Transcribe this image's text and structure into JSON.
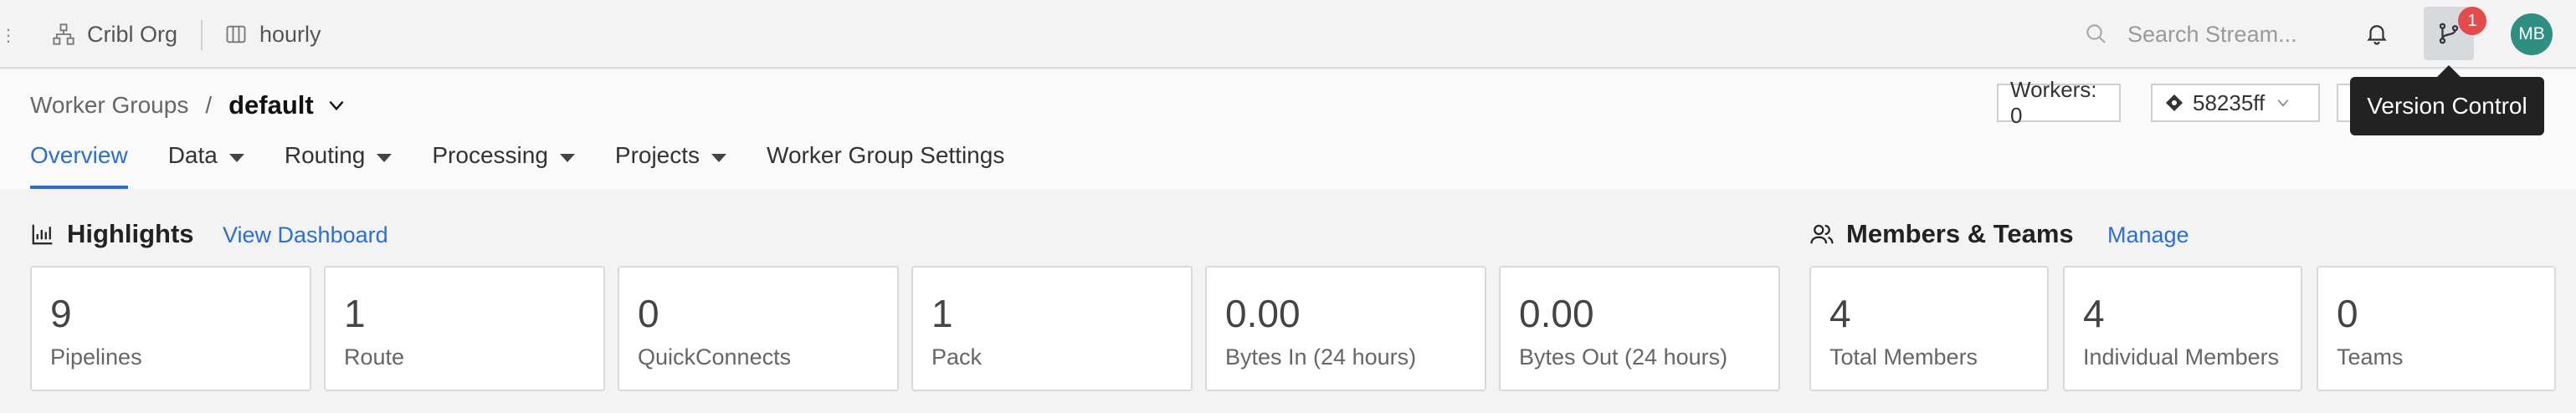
{
  "topbar": {
    "org": "Cribl Org",
    "workspace": "hourly",
    "search_placeholder": "Search Stream...",
    "notification_count": "1",
    "avatar_initials": "MB"
  },
  "breadcrumb": {
    "parent": "Worker Groups",
    "separator": "/",
    "current": "default"
  },
  "tabs": [
    {
      "label": "Overview",
      "active": true
    },
    {
      "label": "Data"
    },
    {
      "label": "Routing"
    },
    {
      "label": "Processing"
    },
    {
      "label": "Projects"
    },
    {
      "label": "Worker Group Settings"
    }
  ],
  "header_controls": {
    "workers": "Workers: 0",
    "commit": "58235ff"
  },
  "tooltip": "Version Control",
  "highlights": {
    "title": "Highlights",
    "link": "View Dashboard",
    "cards": [
      {
        "value": "9",
        "label": "Pipelines"
      },
      {
        "value": "1",
        "label": "Route"
      },
      {
        "value": "0",
        "label": "QuickConnects"
      },
      {
        "value": "1",
        "label": "Pack"
      },
      {
        "value": "0.00",
        "label": "Bytes In (24 hours)"
      },
      {
        "value": "0.00",
        "label": "Bytes Out (24 hours)"
      }
    ]
  },
  "members": {
    "title": "Members & Teams",
    "link": "Manage",
    "cards": [
      {
        "value": "4",
        "label": "Total Members"
      },
      {
        "value": "4",
        "label": "Individual Members"
      },
      {
        "value": "0",
        "label": "Teams"
      }
    ]
  }
}
